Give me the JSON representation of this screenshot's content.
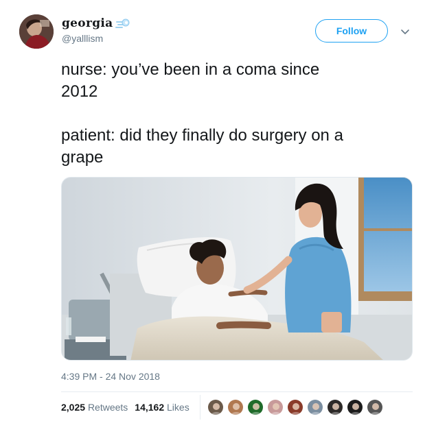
{
  "user": {
    "display_name": "georgia",
    "handle": "@yalllism",
    "name_emoji": "dash-emoji-icon",
    "avatar": "profile-avatar"
  },
  "follow_label": "Follow",
  "tweet": {
    "text": "nurse: you’ve been in a coma since\n2012\n\npatient: did they finally do surgery on a\ngrape",
    "timestamp": "4:39 PM - 24 Nov 2018",
    "retweets_count": "2,025",
    "retweets_label": "Retweets",
    "likes_count": "14,162",
    "likes_label": "Likes"
  },
  "likers": [
    {
      "color": "#6b5a4a"
    },
    {
      "color": "#b07850"
    },
    {
      "color": "#1f6b2a"
    },
    {
      "color": "#c89a9a"
    },
    {
      "color": "#8a3b2a"
    },
    {
      "color": "#7b8ea0"
    },
    {
      "color": "#2d2a28"
    },
    {
      "color": "#1c1c1c"
    },
    {
      "color": "#555555"
    }
  ],
  "colors": {
    "accent": "#1da1f2",
    "text": "#14171a",
    "secondary": "#657786"
  }
}
